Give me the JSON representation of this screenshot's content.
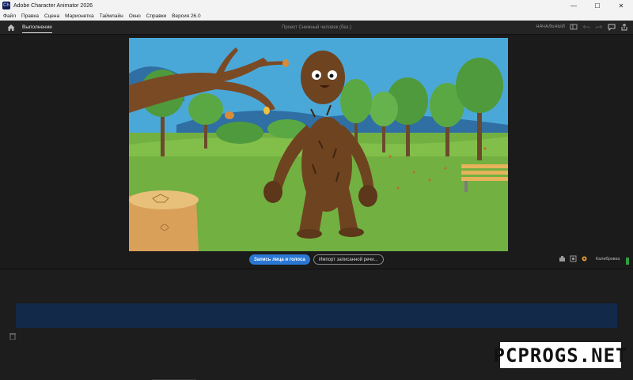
{
  "window": {
    "title": "Adobe Character Animator 2026",
    "logo_text": "Ch",
    "minimize": "—",
    "maximize": "☐",
    "close": "✕"
  },
  "menu": {
    "items": [
      "Файл",
      "Правка",
      "Сцена",
      "Марионетка",
      "Таймлайн",
      "Окно",
      "Справки",
      "Версия 26.0"
    ]
  },
  "workspace": {
    "tab_perform": "Выполнение",
    "project_title": "Проект Снежный человек (без.)",
    "workspace_label": "НАЧАЛЬНЫЙ"
  },
  "stage": {
    "record_button": "Запись лица и голоса",
    "import_button": "Импорт записанной речи...",
    "calibrate_label": "Калибровка"
  },
  "watermark": {
    "text": "PCPROGS.NET"
  },
  "colors": {
    "accent": "#2a78d4",
    "timeline_bar": "#12294a",
    "sky": "#4aa8d8",
    "grass": "#72b041"
  }
}
